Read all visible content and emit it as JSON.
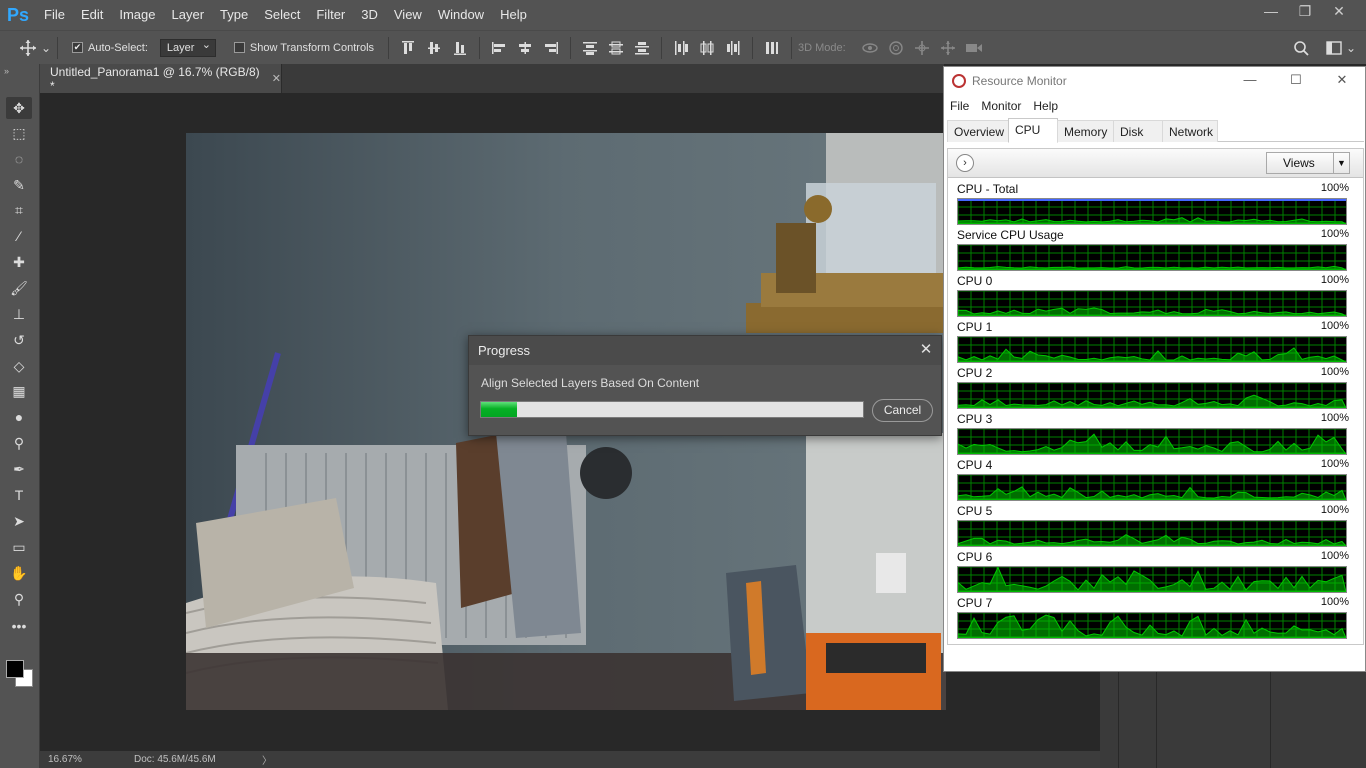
{
  "app": {
    "logo": "Ps",
    "menu": [
      "File",
      "Edit",
      "Image",
      "Layer",
      "Type",
      "Select",
      "Filter",
      "3D",
      "View",
      "Window",
      "Help"
    ],
    "window_controls": {
      "minimize": "—",
      "restore": "❐",
      "close": "✕"
    }
  },
  "options": {
    "auto_select_label": "Auto-Select:",
    "auto_select_checked": true,
    "target_value": "Layer",
    "show_transform_label": "Show Transform Controls",
    "show_transform_checked": false,
    "mode_3d_label": "3D Mode:"
  },
  "tools": [
    {
      "name": "move-tool-icon",
      "glyph": "✥",
      "active": true
    },
    {
      "name": "marquee-tool-icon",
      "glyph": "⬚"
    },
    {
      "name": "lasso-tool-icon",
      "glyph": "◌"
    },
    {
      "name": "quick-select-tool-icon",
      "glyph": "✎"
    },
    {
      "name": "crop-tool-icon",
      "glyph": "⌗"
    },
    {
      "name": "eyedropper-tool-icon",
      "glyph": "⁄"
    },
    {
      "name": "healing-brush-tool-icon",
      "glyph": "✚"
    },
    {
      "name": "brush-tool-icon",
      "glyph": "🖌"
    },
    {
      "name": "stamp-tool-icon",
      "glyph": "⊥"
    },
    {
      "name": "history-brush-tool-icon",
      "glyph": "↺"
    },
    {
      "name": "eraser-tool-icon",
      "glyph": "◇"
    },
    {
      "name": "gradient-tool-icon",
      "glyph": "▦"
    },
    {
      "name": "blur-tool-icon",
      "glyph": "●"
    },
    {
      "name": "dodge-tool-icon",
      "glyph": "⚲"
    },
    {
      "name": "pen-tool-icon",
      "glyph": "✒"
    },
    {
      "name": "type-tool-icon",
      "glyph": "T"
    },
    {
      "name": "path-select-tool-icon",
      "glyph": "➤"
    },
    {
      "name": "shape-tool-icon",
      "glyph": "▭"
    },
    {
      "name": "hand-tool-icon",
      "glyph": "✋"
    },
    {
      "name": "zoom-tool-icon",
      "glyph": "⚲"
    },
    {
      "name": "more-tools-icon",
      "glyph": "•••"
    }
  ],
  "document": {
    "tab_title": "Untitled_Panorama1 @ 16.7% (RGB/8) *",
    "tab_close": "✕"
  },
  "status": {
    "zoom": "16.67%",
    "doc_size": "Doc: 45.6M/45.6M",
    "arrow": "〉"
  },
  "progress": {
    "title": "Progress",
    "message": "Align Selected Layers Based On Content",
    "percent": 9.5,
    "cancel_label": "Cancel",
    "close": "✕"
  },
  "resmon": {
    "title": "Resource Monitor",
    "menu": [
      "File",
      "Monitor",
      "Help"
    ],
    "tabs": [
      "Overview",
      "CPU",
      "Memory",
      "Disk",
      "Network"
    ],
    "active_tab": "CPU",
    "views_label": "Views",
    "graphs": [
      {
        "label": "CPU - Total",
        "max": "100%"
      },
      {
        "label": "Service CPU Usage",
        "max": "100%"
      },
      {
        "label": "CPU 0",
        "max": "100%"
      },
      {
        "label": "CPU 1",
        "max": "100%"
      },
      {
        "label": "CPU 2",
        "max": "100%"
      },
      {
        "label": "CPU 3",
        "max": "100%"
      },
      {
        "label": "CPU 4",
        "max": "100%"
      },
      {
        "label": "CPU 5",
        "max": "100%"
      },
      {
        "label": "CPU 6",
        "max": "100%"
      },
      {
        "label": "CPU 7",
        "max": "100%"
      }
    ]
  },
  "colors": {
    "ps_accent": "#31a8ff",
    "graph_green": "#00c800",
    "graph_grid": "#008000",
    "progress_green": "#06b025"
  }
}
